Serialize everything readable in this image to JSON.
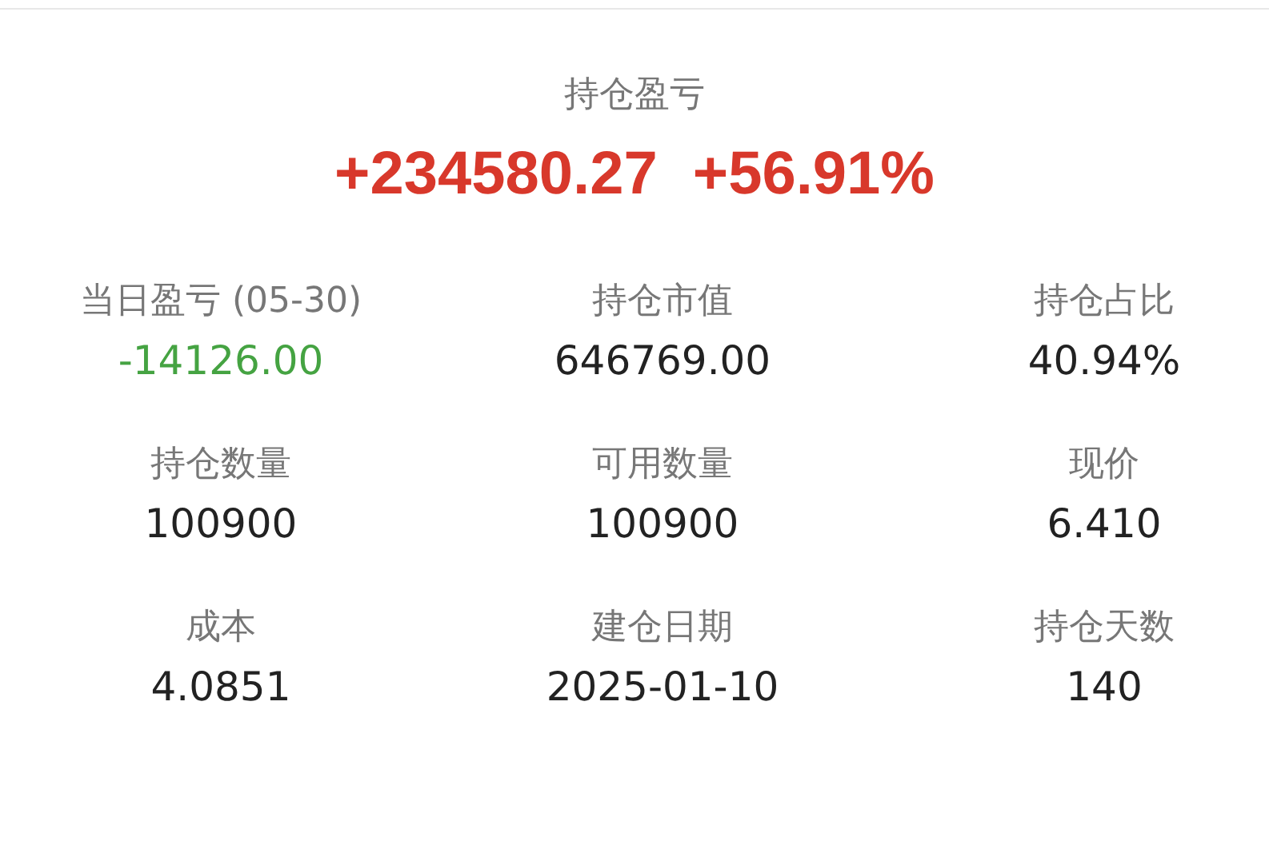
{
  "summary": {
    "label": "持仓盈亏",
    "pnl": "+234580.27",
    "pct": "+56.91%",
    "color": "#d8382b"
  },
  "stats": [
    {
      "label": "当日盈亏 (05-30)",
      "value": "-14126.00",
      "color": "#45a342"
    },
    {
      "label": "持仓市值",
      "value": "646769.00",
      "color": "#222222"
    },
    {
      "label": "持仓占比",
      "value": "40.94%",
      "color": "#222222"
    },
    {
      "label": "持仓数量",
      "value": "100900",
      "color": "#222222"
    },
    {
      "label": "可用数量",
      "value": "100900",
      "color": "#222222"
    },
    {
      "label": "现价",
      "value": "6.410",
      "color": "#222222"
    },
    {
      "label": "成本",
      "value": "4.0851",
      "color": "#222222"
    },
    {
      "label": "建仓日期",
      "value": "2025-01-10",
      "color": "#222222"
    },
    {
      "label": "持仓天数",
      "value": "140",
      "color": "#222222"
    }
  ]
}
